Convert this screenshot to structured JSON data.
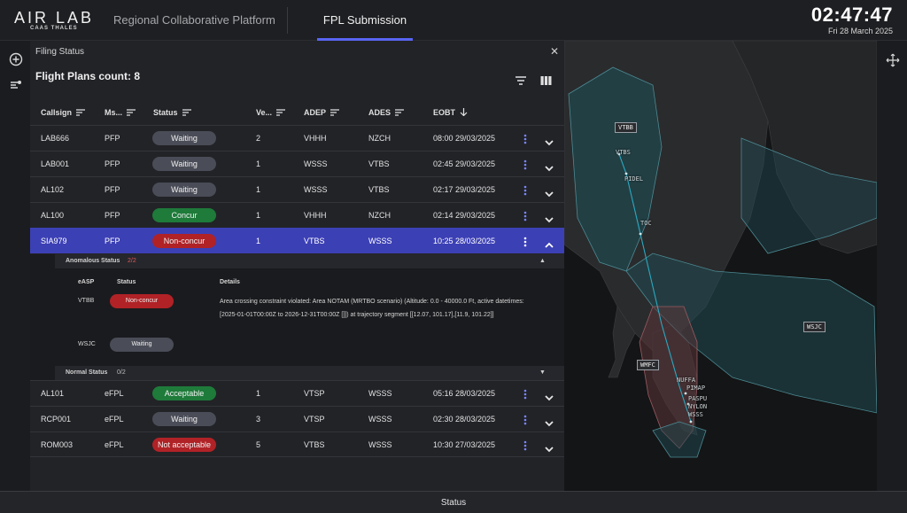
{
  "header": {
    "logo_text": "AIR LAB",
    "logo_sub": "CAAS THALES",
    "platform": "Regional Collaborative Platform",
    "tab": "FPL Submission",
    "time": "02:47:47",
    "date": "Fri 28 March 2025"
  },
  "panel": {
    "title": "Filing Status",
    "count_label": "Flight Plans count: 8",
    "columns": [
      "Callsign",
      "Ms...",
      "Status",
      "Ve...",
      "ADEP",
      "ADES",
      "EOBT"
    ]
  },
  "rows": [
    {
      "callsign": "LAB666",
      "msg": "PFP",
      "status": "Waiting",
      "ver": "2",
      "adep": "VHHH",
      "ades": "NZCH",
      "eobt": "08:00 29/03/2025"
    },
    {
      "callsign": "LAB001",
      "msg": "PFP",
      "status": "Waiting",
      "ver": "1",
      "adep": "WSSS",
      "ades": "VTBS",
      "eobt": "02:45 29/03/2025"
    },
    {
      "callsign": "AL102",
      "msg": "PFP",
      "status": "Waiting",
      "ver": "1",
      "adep": "WSSS",
      "ades": "VTBS",
      "eobt": "02:17 29/03/2025"
    },
    {
      "callsign": "AL100",
      "msg": "PFP",
      "status": "Concur",
      "ver": "1",
      "adep": "VHHH",
      "ades": "NZCH",
      "eobt": "02:14 29/03/2025"
    },
    {
      "callsign": "SIA979",
      "msg": "PFP",
      "status": "Non-concur",
      "ver": "1",
      "adep": "VTBS",
      "ades": "WSSS",
      "eobt": "10:25 28/03/2025"
    },
    {
      "callsign": "AL101",
      "msg": "eFPL",
      "status": "Acceptable",
      "ver": "1",
      "adep": "VTSP",
      "ades": "WSSS",
      "eobt": "05:16 28/03/2025"
    },
    {
      "callsign": "RCP001",
      "msg": "eFPL",
      "status": "Waiting",
      "ver": "3",
      "adep": "VTSP",
      "ades": "WSSS",
      "eobt": "02:30 28/03/2025"
    },
    {
      "callsign": "ROM003",
      "msg": "eFPL",
      "status": "Not acceptable",
      "ver": "5",
      "adep": "VTBS",
      "ades": "WSSS",
      "eobt": "10:30 27/03/2025"
    }
  ],
  "detail": {
    "anomalous_label": "Anomalous Status",
    "anomalous_count": "2/2",
    "normal_label": "Normal Status",
    "normal_count": "0/2",
    "col_easp": "eASP",
    "col_status": "Status",
    "col_details": "Details",
    "entries": [
      {
        "easp": "VTBB",
        "status": "Non-concur",
        "details": "Area crossing constraint violated: Area NOTAM (MRTBO scenario) (Altitude: 0.0 - 40000.0 Ft, active datetimes: [2025-01-01T00:00Z to 2026-12-31T00:00Z []]) at trajectory segment [[12.07, 101.17],[11.9, 101.22]]"
      },
      {
        "easp": "WSJC",
        "status": "Waiting",
        "details": ""
      }
    ]
  },
  "map": {
    "labels": [
      "VTBB",
      "VTBS",
      "PIDEL",
      "TOC",
      "WMFC",
      "WSJC",
      "NUFFA",
      "PIMAP",
      "PASPU",
      "NYLON",
      "WSSS"
    ]
  },
  "statusbar": {
    "label": "Status"
  },
  "colors": {
    "accent": "#5865f2",
    "selected_row": "#3c40b5",
    "concur": "#1e7b3a",
    "noncon": "#b02226",
    "waiting": "#4a4c57"
  }
}
